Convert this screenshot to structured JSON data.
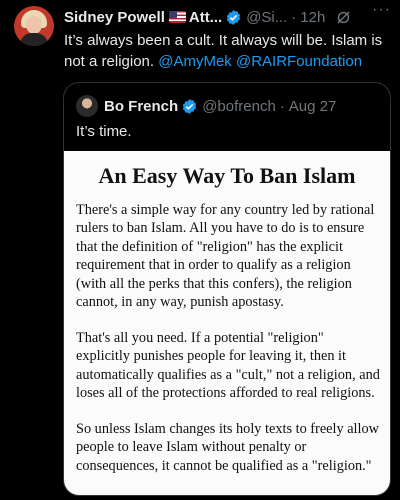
{
  "tweet": {
    "author_name": "Sidney Powell",
    "author_name_suffix": "Att...",
    "handle": "@Si...",
    "separator": "·",
    "time": "12h",
    "more": "···",
    "text_plain": "It’s always been a cult. It always will be. Islam is not a religion.",
    "mention_1": "@AmyMek",
    "mention_2": "@RAIRFoundation",
    "icons": [
      "us-flag-icon",
      "verified-badge-icon",
      "grok-icon",
      "more-icon"
    ]
  },
  "quote": {
    "author_name": "Bo French",
    "handle": "@bofrench",
    "separator": "·",
    "date": "Aug 27",
    "text": "It’s time.",
    "image": {
      "title": "An Easy Way To Ban Islam",
      "paragraph_1": "There's a simple way for any country led by rational rulers to ban Islam. All you have to do is to ensure that the definition of \"religion\" has the explicit requirement that in order to qualify as a religion (with all the perks that this confers), the religion cannot, in any way, punish apostasy.",
      "paragraph_2": "That's all you need. If a potential \"religion\" explicitly punishes people for leaving it, then it automatically qualifies as a \"cult,\" not a religion, and loses all of the protections afforded to real religions.",
      "paragraph_3": "So unless Islam changes its holy texts to freely allow people to leave Islam without penalty or consequences, it cannot be qualified as a \"religion.\""
    }
  },
  "colors": {
    "background": "#000000",
    "text": "#e7e9ea",
    "muted": "#71767b",
    "link": "#1d9bf0",
    "border": "#2f3336",
    "verified": "#1d9bf0"
  }
}
